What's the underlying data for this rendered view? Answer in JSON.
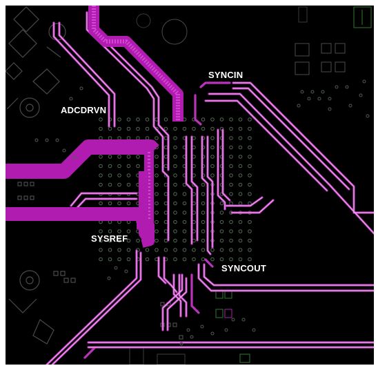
{
  "labels": {
    "syncin": "SYNCIN",
    "adcdrvn": "ADCDRVN",
    "sysref": "SYSREF",
    "syncout": "SYNCOUT"
  },
  "colors": {
    "background": "#000000",
    "trace": "#cc33cc",
    "trace_core": "#e8b5e8",
    "wide_trace": "#b81fb8",
    "via": "#556b55",
    "pad_outline": "#4f4f4f",
    "green_outline": "#2f7a2f",
    "text": "#ffffff"
  }
}
